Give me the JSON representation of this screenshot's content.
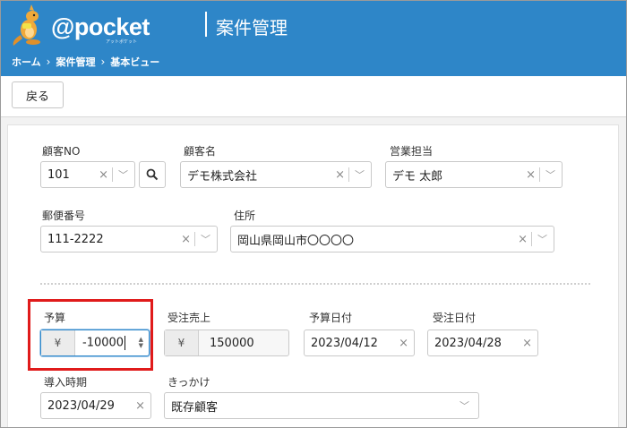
{
  "header": {
    "logo_text": "@pocket",
    "logo_sub": "アットポケット",
    "app_title": "案件管理",
    "breadcrumb": [
      "ホーム",
      "案件管理",
      "基本ビュー"
    ]
  },
  "toolbar": {
    "back_label": "戻る"
  },
  "form": {
    "customer_no": {
      "label": "顧客NO",
      "value": "101"
    },
    "customer_name": {
      "label": "顧客名",
      "value": "デモ株式会社"
    },
    "sales_rep": {
      "label": "営業担当",
      "value": "デモ 太郎"
    },
    "postal_code": {
      "label": "郵便番号",
      "value": "111-2222"
    },
    "address": {
      "label": "住所",
      "value": "岡山県岡山市〇〇〇〇"
    },
    "budget": {
      "label": "予算",
      "currency": "¥",
      "value": "-10000"
    },
    "order_sales": {
      "label": "受注売上",
      "currency": "¥",
      "value": "150000"
    },
    "budget_date": {
      "label": "予算日付",
      "value": "2023/04/12"
    },
    "order_date": {
      "label": "受注日付",
      "value": "2023/04/28"
    },
    "introduction_date": {
      "label": "導入時期",
      "value": "2023/04/29"
    },
    "trigger": {
      "label": "きっかけ",
      "value": "既存顧客"
    }
  },
  "colors": {
    "header_bg": "#2e86c8",
    "highlight": "#e01b1b"
  }
}
